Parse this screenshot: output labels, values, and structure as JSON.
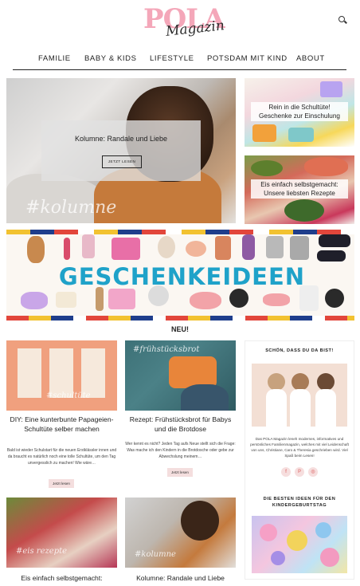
{
  "header": {
    "logo_main": "POLA",
    "logo_sub": "Magazin"
  },
  "nav": {
    "items": [
      "FAMILIE",
      "BABY & KIDS",
      "LIFESTYLE",
      "POTSDAM MIT KIND",
      "ABOUT"
    ]
  },
  "hero": {
    "hashtag": "#kolumne",
    "title": "Kolumne: Randale und Liebe",
    "button": "JETZT LESEN"
  },
  "side_tiles": [
    {
      "title": "Rein in die Schultüte! Geschenke zur Einschulung"
    },
    {
      "title": "Eis einfach selbstgemacht: Unsere liebsten Rezepte"
    }
  ],
  "banner": {
    "text": "GESCHENKEIDEEN"
  },
  "section_label": "NEU!",
  "posts": [
    {
      "title": "DIY: Eine kunterbunte Papageien-Schultüte selber machen",
      "excerpt": "Bald ist wieder Schulstart für die neuen Erstklässler innen und da braucht es natürlich noch eine tolle Schultüte, um den Tag unvergesslich zu machen! Wie wäre…",
      "button": "Jetzt lesen",
      "hashtag": "#schultüte"
    },
    {
      "title": "Rezept: Frühstücksbrot für Babys und die Brotdose",
      "excerpt": "Wer kennt es nicht? Jeden Tag aufs Neue stellt sich die Frage: Was mache ich den Kindern in die Brotdosche oder gebe zur Abwechslung meinem…",
      "button": "Jetzt lesen",
      "hashtag": "#frühstücksbrot"
    },
    {
      "title": "Eis einfach selbstgemacht:",
      "hashtag": "#eis rezepte"
    },
    {
      "title": "Kolumne: Randale und Liebe",
      "hashtag": "#kolumne"
    }
  ],
  "sidebar": {
    "welcome_heading": "SCHÖN, DASS DU DA BIST!",
    "about_text": "Das POLA Magazin leneh modernes, informatives und persönliches Familienmagazin, welches mit viel Leidenschaft von uns, Christiane, Caro & Theresia geschrieben wird. Viel Spaß beim Lesen!",
    "social": [
      "f",
      "P",
      "◎"
    ],
    "ideas_heading": "DIE BESTEN IDEEN FÜR DEN KINDERGEBURTSTAG"
  },
  "colors": {
    "accent_pink": "#f4a7b9",
    "banner_blue": "#1fa2c9",
    "button_pink": "#f4dede"
  }
}
